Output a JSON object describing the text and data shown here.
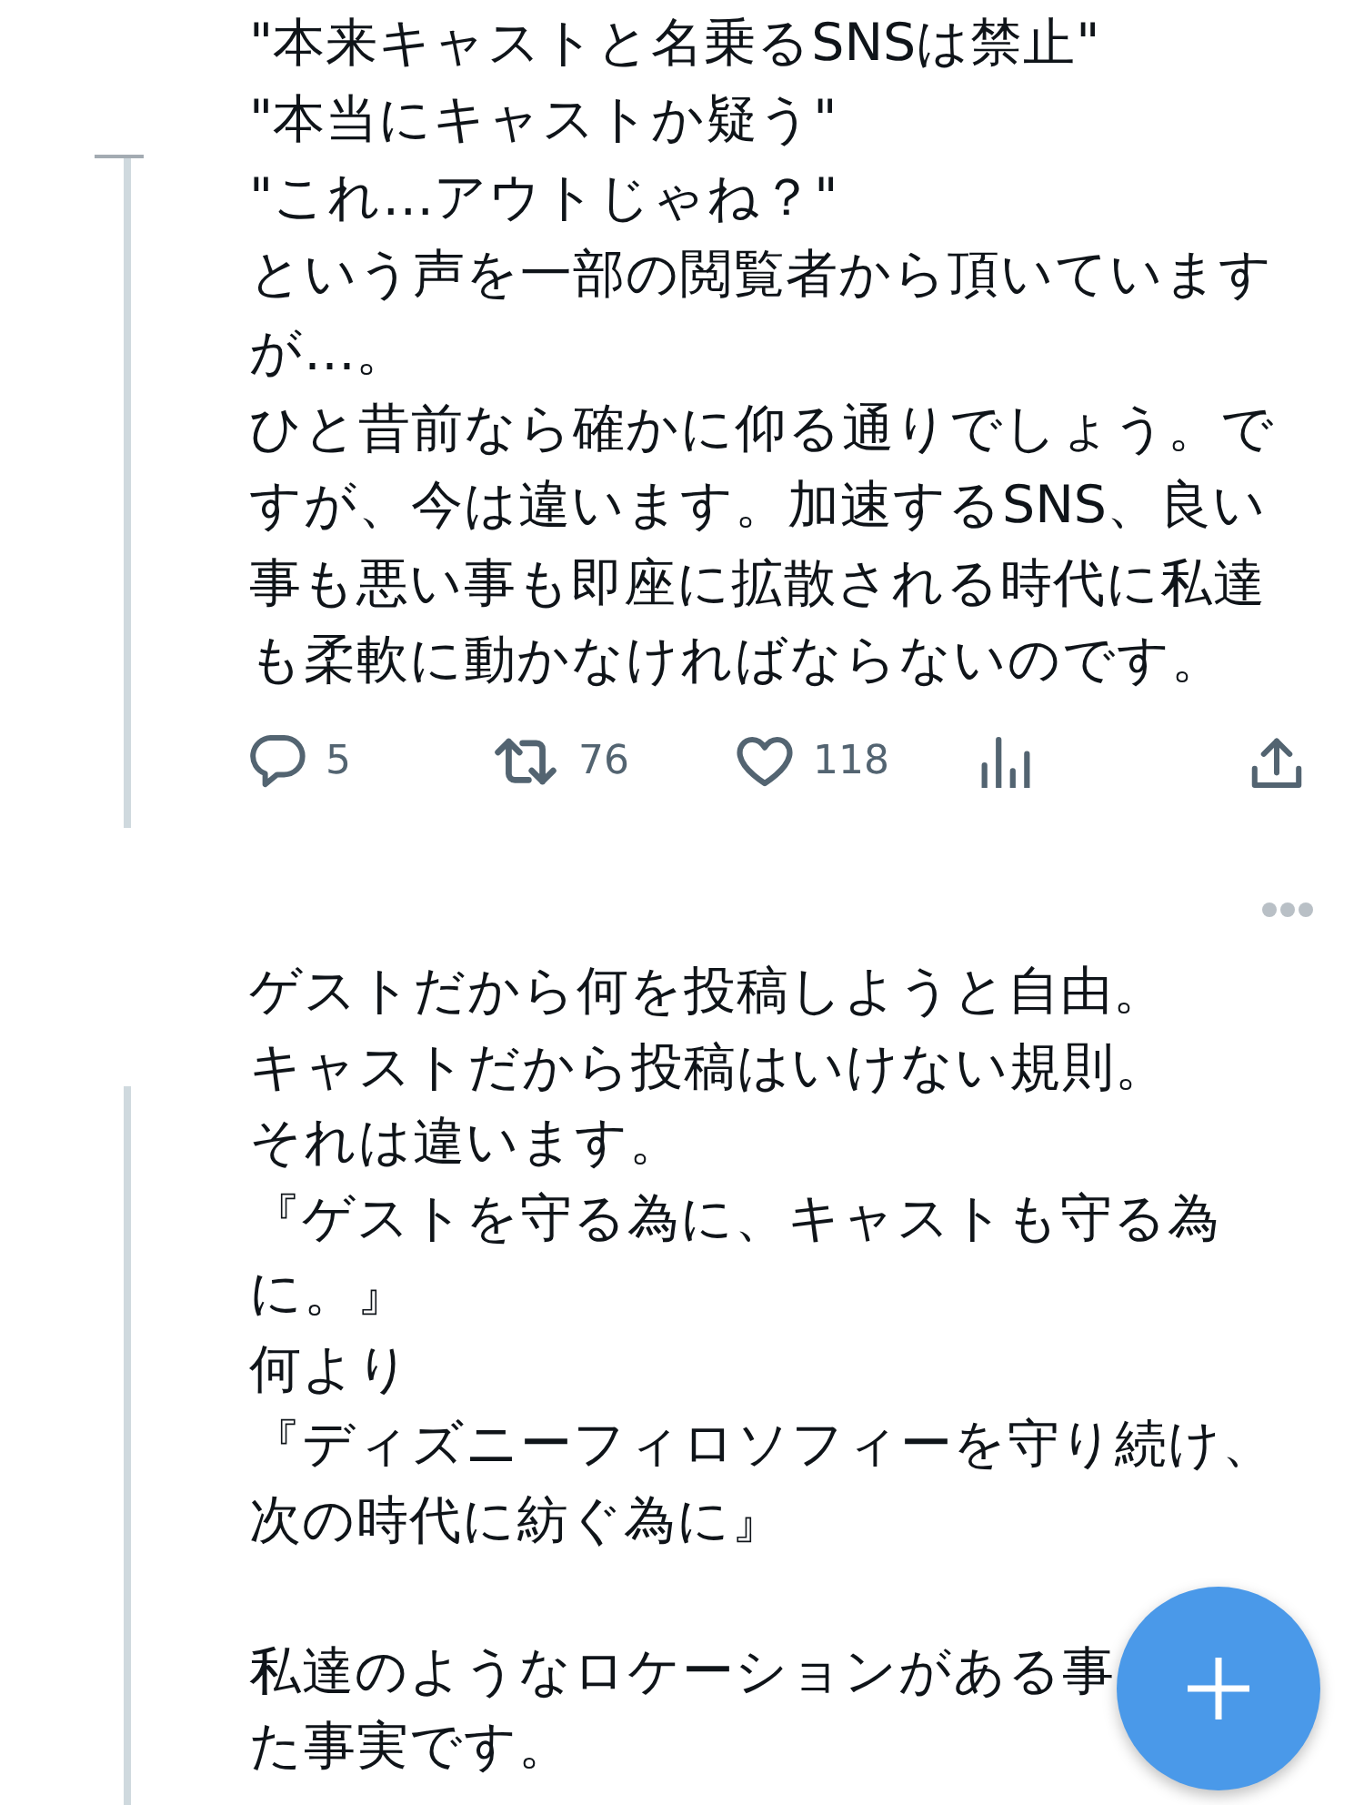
{
  "tweets": [
    {
      "blocks": [
        [
          "\"本来キャストと名乗るSNSは禁止\"",
          "\"本当にキャストか疑う\"",
          "\"これ…アウトじゃね？\"",
          "という声を一部の閲覧者から頂いていますが…。",
          "ひと昔前なら確かに仰る通りでしょう。ですが、今は違います。加速するSNS、良い事も悪い事も即座に拡散される時代に私達も柔軟に動かなければならないのです。"
        ]
      ],
      "actions": [
        {
          "kind": "reply",
          "count": "5"
        },
        {
          "kind": "retweet",
          "count": "76"
        },
        {
          "kind": "like",
          "count": "118"
        },
        {
          "kind": "analytics"
        },
        {
          "kind": "share"
        }
      ]
    },
    {
      "more_button": true,
      "blocks": [
        [
          "ゲストだから何を投稿しようと自由。",
          "キャストだから投稿はいけない規則。",
          "それは違います。",
          "『ゲストを守る為に、キャストも守る為に。』",
          "何より",
          "『ディズニーフィロソフィーを守り続け、次の時代に紡ぐ為に』"
        ],
        [
          "私達のようなロケーションがある事",
          "た事実です。"
        ]
      ]
    }
  ]
}
